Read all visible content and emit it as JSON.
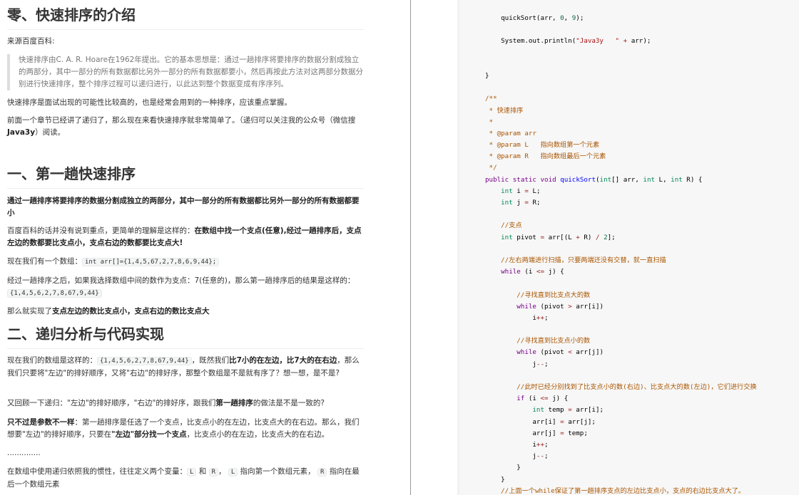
{
  "article": {
    "h0": "零、快速排序的介绍",
    "source_label": "来源百度百科:",
    "quote": "快速排序由C. A. R. Hoare在1962年提出。它的基本思想是：通过一趟排序将要排序的数据分割成独立的两部分，其中一部分的所有数据都比另外一部分的所有数据都要小，然后再按此方法对这两部分数据分别进行快速排序，整个排序过程可以递归进行，以此达到整个数据变成有序序列。",
    "p_interview": "快速排序是面试出现的可能性比较高的，也是经常会用到的一种排序，应该重点掌握。",
    "p_prev_a": "前面一个章节已经讲了递归了，那么现在来看快速排序就非常简单了。（递归可以关注我的公众号（微信搜",
    "p_prev_bold": "Java3y",
    "p_prev_b": "）阅读。",
    "h1": "一、第一趟快速排序",
    "p_bold_def": "通过一趟排序将要排序的数据分割成独立的两部分，其中一部分的所有数据都比另外一部分的所有数据都要小",
    "p_simple_a": "百度百科的话并没有说到重点，更简单的理解是这样的：",
    "p_simple_bold": "在数组中找一个支点(任意),经过一趟排序后，支点左边的数都要比支点小，支点右边的数都要比支点大!",
    "p_array_a": "现在我们有一个数组：",
    "p_array_code": "int arr[]={1,4,5,67,2,7,8,6,9,44};",
    "p_after_a": "经过一趟排序之后，如果我选择数组中间的数作为支点：7(任意的)，那么第一趟排序后的结果是这样的：",
    "p_after_code": "{1,4,5,6,2,7,8,67,9,44}",
    "p_result_a": "那么就实现了",
    "p_result_bold": "支点左边的数比支点小，支点右边的数比支点大",
    "h2": "二、递归分析与代码实现",
    "p_now_a": "现在我们的数组是这样的：",
    "p_now_code": "{1,4,5,6,2,7,8,67,9,44}",
    "p_now_b": "，既然我们",
    "p_now_bold1": "比7小的在左边，比7大的在右边",
    "p_now_c": "，那么我们只要将\"左边\"的排好顺序，又将\"右边\"的排好序，那整个数组是不是就有序了？想一想，是不是?",
    "p_review_a": "又回顾一下递归：\"左边\"的排好顺序，\"右边\"的排好序，跟我们",
    "p_review_bold": "第一趟排序",
    "p_review_b": "的做法是不是一致的?",
    "p_param_bold": "只不过是参数不一样",
    "p_param_a": "：第一趟排序是任选了一个支点，比支点小的在左边，比支点大的在右边。那么，我们想要\"左边\"的排好顺序，只要在",
    "p_param_bold2": "\"左边\"部分找一个支点",
    "p_param_b": "，比支点小的在左边，比支点大的在右边。",
    "ellipsis": "..............",
    "p_lr_a": "在数组中使用递归依照我的惯性，往往定义两个变量：",
    "p_lr_L": "L",
    "p_lr_and": "和",
    "p_lr_R": "R",
    "p_lr_b": "，",
    "p_lr_L2": "L",
    "p_lr_c": "指向第一个数组元素，",
    "p_lr_R2": "R",
    "p_lr_d": "指向在最后一个数组元素"
  },
  "code": {
    "lines": [
      "    quickSort(arr, 0, 9);",
      "",
      "    System.out.println(\"Java3y   \" + arr);",
      "",
      "",
      "}",
      "",
      "/**",
      " * 快速排序",
      " *",
      " * @param arr",
      " * @param L   指向数组第一个元素",
      " * @param R   指向数组最后一个元素",
      " */",
      "public static void quickSort(int[] arr, int L, int R) {",
      "    int i = L;",
      "    int j = R;",
      "",
      "    //支点",
      "    int pivot = arr[(L + R) / 2];",
      "",
      "    //左右两端进行扫描，只要两端还没有交替，就一直扫描",
      "    while (i <= j) {",
      "",
      "        //寻找直到比支点大的数",
      "        while (pivot > arr[i])",
      "            i++;",
      "",
      "        //寻找直到比支点小的数",
      "        while (pivot < arr[j])",
      "            j--;",
      "",
      "        //此时已经分别找到了比支点小的数(右边)、比支点大的数(左边)，它们进行交换",
      "        if (i <= j) {",
      "            int temp = arr[i];",
      "            arr[i] = arr[j];",
      "            arr[j] = temp;",
      "            i++;",
      "            j--;",
      "        }",
      "    }",
      "    //上面一个while保证了第一趟排序支点的左边比支点小，支点的右边比支点大了。"
    ]
  },
  "colors": {
    "keyword": "#770088",
    "type": "#008855",
    "function": "#0000ff",
    "comment": "#aa5500",
    "operator": "#981a1a",
    "string": "#aa1111",
    "number": "#116644",
    "code_bg": "#f7f7f7"
  }
}
